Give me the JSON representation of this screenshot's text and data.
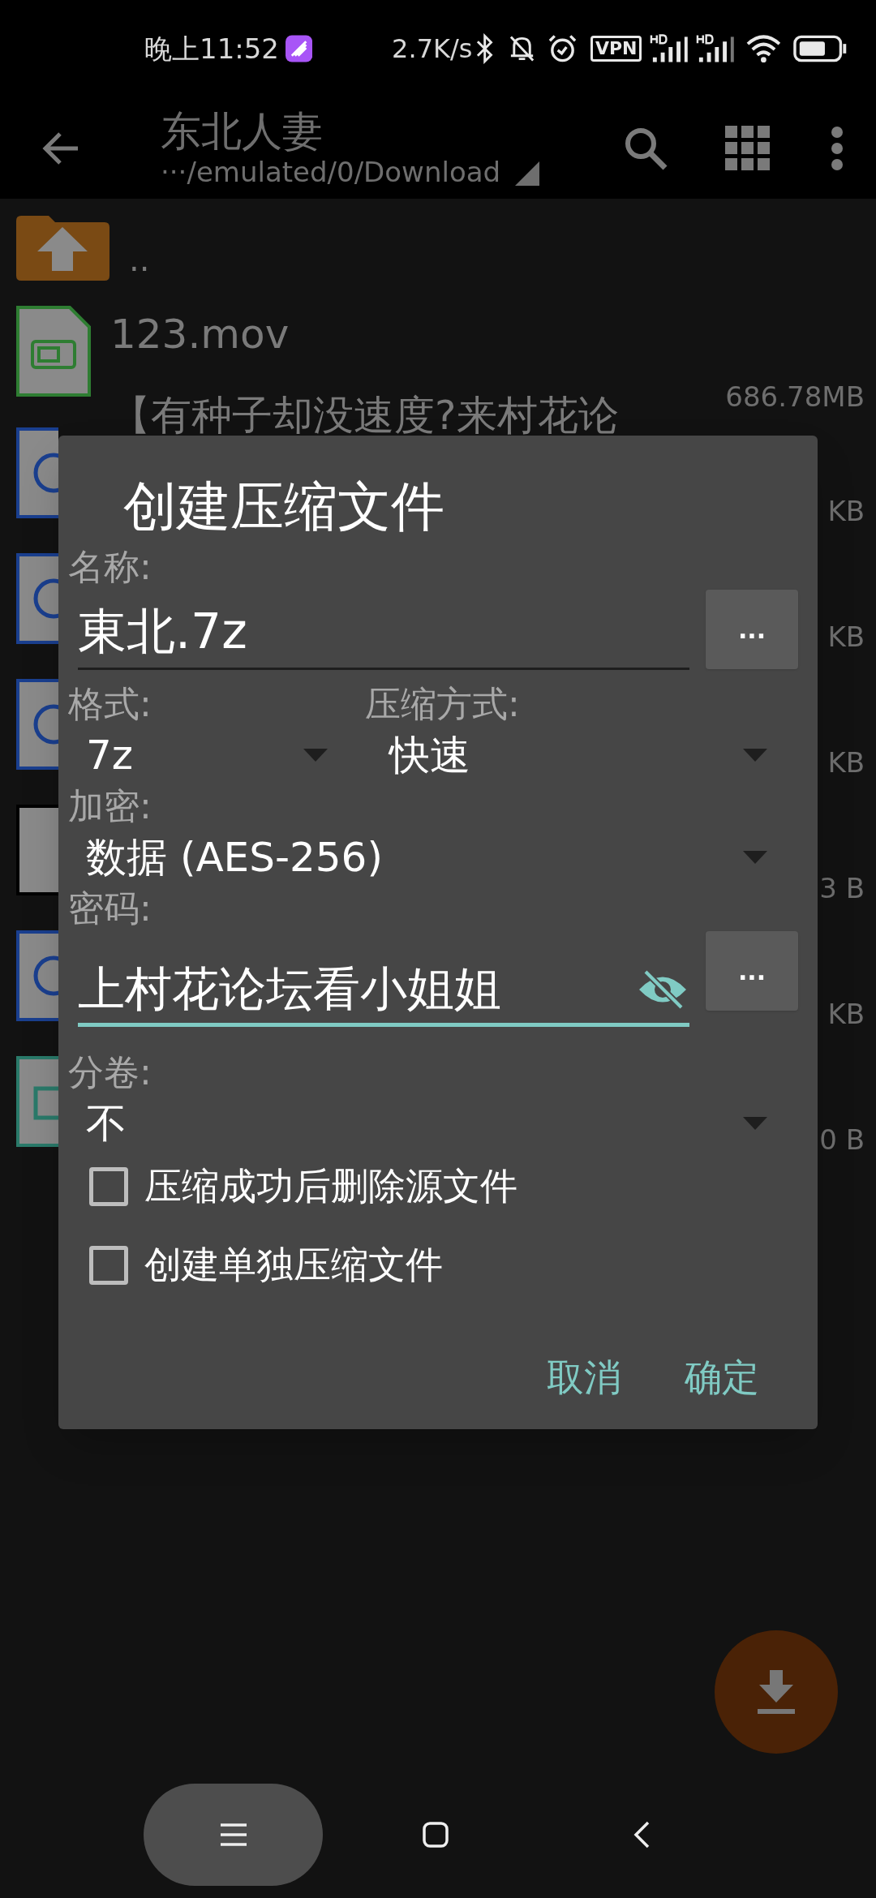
{
  "status_bar": {
    "time": "晚上11:52",
    "net_speed": "2.7K/s",
    "vpn": "VPN"
  },
  "app_bar": {
    "title": "东北人妻",
    "path": "···/emulated/0/Download"
  },
  "files": [
    {
      "kind": "parent",
      "name": ".."
    },
    {
      "kind": "video",
      "name": "123.mov",
      "size": "686.78MB"
    },
    {
      "kind": "doc",
      "name": "【有种子却没速度?来村花论",
      "size": "KB"
    },
    {
      "kind": "doc",
      "size": "KB"
    },
    {
      "kind": "doc",
      "size": "KB"
    },
    {
      "kind": "blank",
      "size": "3 B"
    },
    {
      "kind": "doc",
      "size": "KB"
    },
    {
      "kind": "image",
      "size": "0 B"
    }
  ],
  "dialog": {
    "title": "创建压缩文件",
    "name": {
      "label": "名称:",
      "value": "東北.7z",
      "button": "..."
    },
    "format": {
      "label": "格式:",
      "value": "7z"
    },
    "method": {
      "label": "压缩方式:",
      "value": "快速"
    },
    "encryption": {
      "label": "加密:",
      "value": "数据 (AES-256)"
    },
    "password": {
      "label": "密码:",
      "value": "上村花论坛看小姐姐",
      "button": "..."
    },
    "split": {
      "label": "分卷:",
      "value": "不"
    },
    "options": [
      {
        "label": "压缩成功后删除源文件",
        "checked": false
      },
      {
        "label": "创建单独压缩文件",
        "checked": false
      }
    ],
    "buttons": [
      "取消",
      "确定"
    ]
  }
}
